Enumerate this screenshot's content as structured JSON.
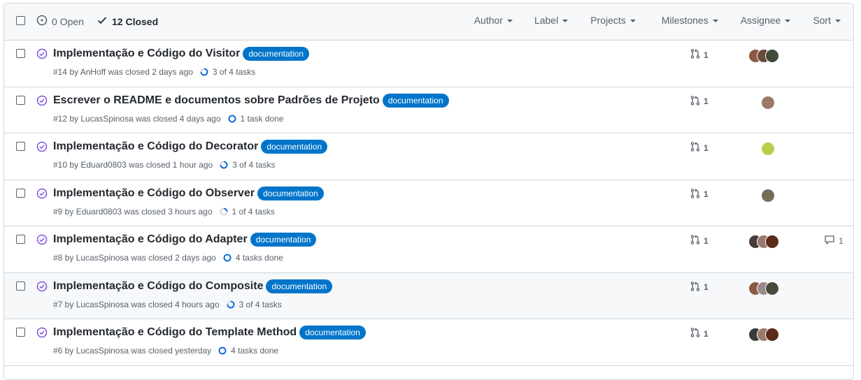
{
  "header": {
    "open_label": "0 Open",
    "closed_label": "12 Closed",
    "filters": [
      "Author",
      "Label",
      "Projects",
      "Milestones",
      "Assignee",
      "Sort"
    ]
  },
  "issues": [
    {
      "title": "Implementação e Código do Visitor",
      "label": "documentation",
      "meta": "#14 by AnHoff was closed 2 days ago",
      "tasks": "3 of 4 tasks",
      "progress": 0.75,
      "prs": "1",
      "assignees": [
        "#8a5a44",
        "#6b4a3a",
        "#3f4a3a"
      ],
      "comments": ""
    },
    {
      "title": "Escrever o README e documentos sobre Padrões de Projeto",
      "label": "documentation",
      "meta": "#12 by LucasSpinosa was closed 4 days ago",
      "tasks": "1 task done",
      "progress": 1,
      "prs": "1",
      "assignees": [
        "#9b7a6a"
      ],
      "comments": ""
    },
    {
      "title": "Implementação e Código do Decorator",
      "label": "documentation",
      "meta": "#10 by Eduard0803 was closed 1 hour ago",
      "tasks": "3 of 4 tasks",
      "progress": 0.75,
      "prs": "1",
      "assignees": [
        "#b6cf4a"
      ],
      "comments": ""
    },
    {
      "title": "Implementação e Código do Observer",
      "label": "documentation",
      "meta": "#9 by Eduard0803 was closed 3 hours ago",
      "tasks": "1 of 4 tasks",
      "progress": 0.25,
      "prs": "1",
      "assignees": [
        "#7a6a5a"
      ],
      "comments": ""
    },
    {
      "title": "Implementação e Código do Adapter",
      "label": "documentation",
      "meta": "#8 by LucasSpinosa was closed 2 days ago",
      "tasks": "4 tasks done",
      "progress": 1,
      "prs": "1",
      "assignees": [
        "#4a3a3a",
        "#9a7a6a",
        "#5a2a1a"
      ],
      "comments": "1"
    },
    {
      "title": "Implementação e Código do Composite",
      "label": "documentation",
      "meta": "#7 by LucasSpinosa was closed 4 hours ago",
      "tasks": "3 of 4 tasks",
      "progress": 0.75,
      "prs": "1",
      "assignees": [
        "#8a5a44",
        "#9a8a8a",
        "#4a4a3a"
      ],
      "comments": ""
    },
    {
      "title": "Implementação e Código do Template Method",
      "label": "documentation",
      "meta": "#6 by LucasSpinosa was closed yesterday",
      "tasks": "4 tasks done",
      "progress": 1,
      "prs": "1",
      "assignees": [
        "#3a3a3a",
        "#9a7a6a",
        "#5a2a1a"
      ],
      "comments": ""
    }
  ],
  "colors": {
    "closed_purple": "#8250df",
    "label_blue": "#0075ca",
    "progress_blue": "#0969da"
  },
  "icons": {
    "open": "issue-opened-icon",
    "closed": "check-icon",
    "status": "issue-closed-icon",
    "pr": "git-pull-request-icon",
    "comment": "comment-icon"
  }
}
